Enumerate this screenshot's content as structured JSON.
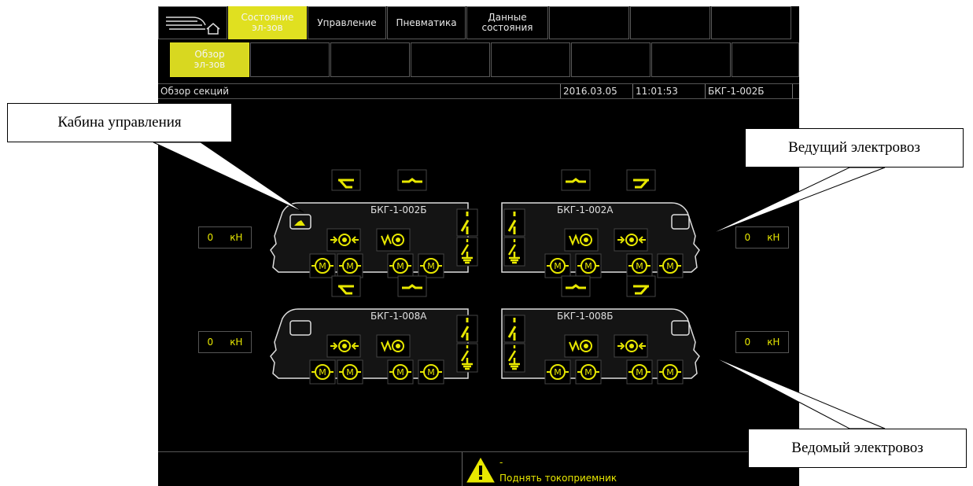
{
  "top_tabs": [
    "Состояние\nэл-зов",
    "Управление",
    "Пневматика",
    "Данные\nсостояния",
    "",
    "",
    ""
  ],
  "sub_tabs": [
    "Обзор\nэл-зов",
    "",
    "",
    "",
    "",
    "",
    "",
    ""
  ],
  "status": {
    "title": "Обзор секций",
    "date": "2016.03.05",
    "time": "11:01:53",
    "loco": "БКГ-1-002Б"
  },
  "sections": {
    "tl": "БКГ-1-002Б",
    "tr": "БКГ-1-002А",
    "bl": "БКГ-1-008А",
    "br": "БКГ-1-008Б"
  },
  "force": [
    {
      "value": "0",
      "unit": "кН"
    },
    {
      "value": "0",
      "unit": "кН"
    },
    {
      "value": "0",
      "unit": "кН"
    },
    {
      "value": "0",
      "unit": "кН"
    }
  ],
  "motor_label": "M",
  "warning": {
    "line1": "-",
    "line2": "Поднять токоприемник"
  },
  "callouts": {
    "cab": "Кабина управления",
    "lead": "Ведущий электровоз",
    "slave": "Ведомый электровоз"
  },
  "colors": {
    "accent": "#e0e020",
    "screen_bg": "#000000",
    "icon": "#e8e800"
  },
  "icons": [
    "home-icon",
    "pantograph-icon",
    "coupler-icon",
    "brake-icon",
    "disconnector-icon",
    "ground-switch-icon",
    "motor-icon",
    "cab-icon",
    "warning-icon"
  ]
}
